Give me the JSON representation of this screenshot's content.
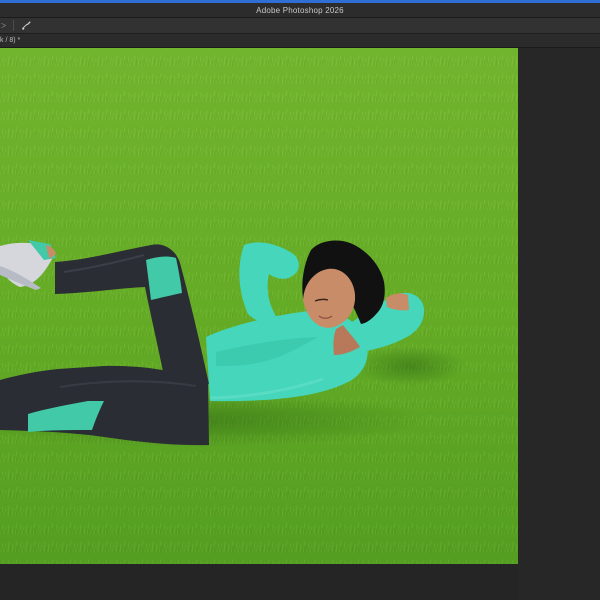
{
  "window": {
    "title": "Adobe Photoshop 2026"
  },
  "toolbar": {
    "tool_label": "ᐳ",
    "brush_icon": "brush-pressure-icon"
  },
  "tab": {
    "doc_label": "k / 8) *"
  },
  "canvas": {
    "subject": "woman doing crunches on grass",
    "colors": {
      "grass": "#5ea622",
      "grass_light": "#8dcc3e",
      "grass_dark": "#3f7f17",
      "top": "#45d6bc",
      "leggings": "#2a2d33",
      "panel": "#42c9a7",
      "hair": "#111111",
      "skin": "#c88d68"
    }
  },
  "colors": {
    "accent": "#2f6ed3",
    "titlebar": "#2c2c2c",
    "toolbar": "#323232",
    "pasteboard": "#272727"
  }
}
